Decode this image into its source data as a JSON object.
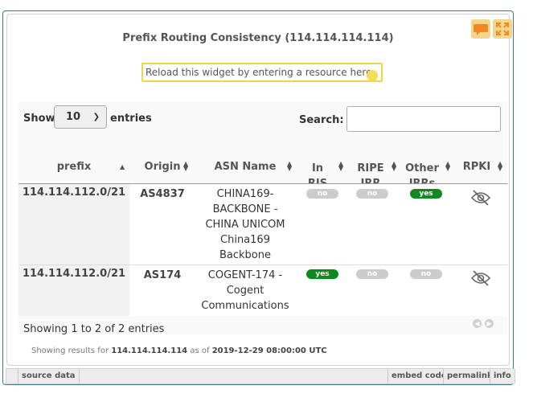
{
  "widget": {
    "title": "Prefix Routing Consistency (114.114.114.114)",
    "reload_placeholder": "Reload this widget by entering a resource here",
    "colors": {
      "border": "#3b7a8a",
      "accent": "#f0d34a",
      "yes": "#0c8a1e",
      "no": "#cccccc"
    }
  },
  "controls": {
    "show_label": "Show",
    "page_size": "10",
    "entries_label": "entries",
    "search_label": "Search:"
  },
  "table": {
    "columns": [
      {
        "key": "prefix",
        "label": "prefix"
      },
      {
        "key": "origin",
        "label": "Origin"
      },
      {
        "key": "asn_name",
        "label": "ASN Name"
      },
      {
        "key": "in_ris",
        "label": "In\nRIS"
      },
      {
        "key": "ripe_irr",
        "label": "RIPE\nIRR"
      },
      {
        "key": "other_irrs",
        "label": "Other\nIRRs"
      },
      {
        "key": "rpki",
        "label": "RPKI"
      }
    ],
    "rows": [
      {
        "prefix": "114.114.112.0/21",
        "origin": "AS4837",
        "asn_name": [
          "CHINA169-",
          "BACKBONE -",
          "CHINA UNICOM",
          "China169",
          "Backbone"
        ],
        "in_ris": "no",
        "ripe_irr": "no",
        "other_irrs": "yes",
        "rpki_icon": "eye-slash-icon"
      },
      {
        "prefix": "114.114.112.0/21",
        "origin": "AS174",
        "asn_name": [
          "COGENT-174 -",
          "Cogent",
          "Communications"
        ],
        "in_ris": "yes",
        "ripe_irr": "no",
        "other_irrs": "no",
        "rpki_icon": "eye-slash-icon"
      }
    ],
    "info": "Showing 1 to 2 of 2 entries"
  },
  "results": {
    "prefix_text": "Showing results for",
    "resource": "114.114.114.114",
    "as_of": "as of",
    "timestamp": "2019-12-29 08:00:00 UTC"
  },
  "bottom_bar": {
    "source_data": "source data",
    "embed_code": "embed code",
    "permalink": "permalink",
    "info": "info"
  }
}
